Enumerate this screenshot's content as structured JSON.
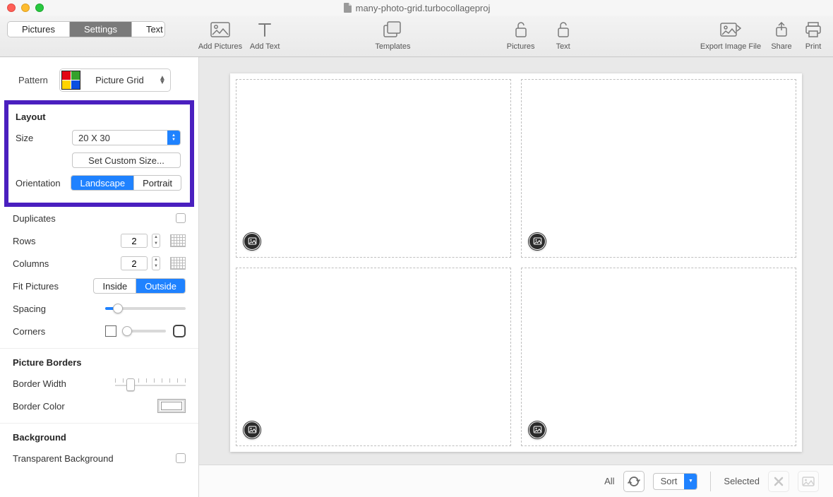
{
  "window": {
    "title": "many-photo-grid.turbocollageproj"
  },
  "tabs": {
    "pictures": "Pictures",
    "settings": "Settings",
    "text": "Text",
    "active": "settings"
  },
  "toolbar": {
    "addPictures": "Add Pictures",
    "addText": "Add Text",
    "templates": "Templates",
    "lockPictures": "Pictures",
    "lockText": "Text",
    "exportImage": "Export Image File",
    "share": "Share",
    "print": "Print"
  },
  "pattern": {
    "label": "Pattern",
    "value": "Picture Grid"
  },
  "layout": {
    "heading": "Layout",
    "sizeLabel": "Size",
    "sizeValue": "20 X 30",
    "customSizeBtn": "Set Custom Size...",
    "orientationLabel": "Orientation",
    "orientation": {
      "a": "Landscape",
      "b": "Portrait",
      "active": "a"
    }
  },
  "grid": {
    "duplicatesLabel": "Duplicates",
    "rowsLabel": "Rows",
    "rowsValue": "2",
    "columnsLabel": "Columns",
    "columnsValue": "2",
    "fitLabel": "Fit Pictures",
    "fit": {
      "a": "Inside",
      "b": "Outside",
      "active": "b"
    },
    "spacingLabel": "Spacing",
    "spacingPct": 16,
    "cornersLabel": "Corners",
    "cornersPct": 8
  },
  "borders": {
    "heading": "Picture Borders",
    "widthLabel": "Border Width",
    "widthPct": 22,
    "colorLabel": "Border Color"
  },
  "background": {
    "heading": "Background",
    "transparentLabel": "Transparent Background"
  },
  "footer": {
    "allLabel": "All",
    "sortLabel": "Sort",
    "selectedLabel": "Selected"
  }
}
